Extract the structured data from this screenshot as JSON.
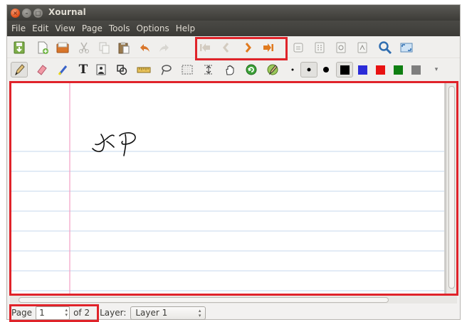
{
  "window": {
    "title": "Xournal"
  },
  "menu": [
    "File",
    "Edit",
    "View",
    "Page",
    "Tools",
    "Options",
    "Help"
  ],
  "toolbar1": {
    "icons": [
      "save-icon",
      "new-page-icon",
      "open-icon",
      "cut-icon",
      "copy-icon",
      "paste-icon",
      "undo-icon",
      "redo-icon",
      "first-page-icon",
      "previous-page-icon",
      "next-page-icon",
      "last-page-icon",
      "layer-icon",
      "page-layout-icon",
      "zoom-fit-icon",
      "zoom-out-icon",
      "zoom-icon",
      "fullscreen-icon"
    ]
  },
  "toolbar2": {
    "icons": [
      "pen-icon",
      "eraser-icon",
      "highlighter-icon",
      "text-icon",
      "image-icon",
      "shape-icon",
      "ruler-icon",
      "lasso-icon",
      "select-rect-icon",
      "vertical-space-icon",
      "hand-icon",
      "default-tool-icon",
      "default-pen-icon"
    ],
    "text_tool_label": "T",
    "colors": [
      "#000000",
      "#2c2cd8",
      "#e81212",
      "#0f7f12",
      "#7e7e7e"
    ]
  },
  "colors": {
    "highlight": "#e0232a",
    "rule_line": "#c4d7ec",
    "margin_line": "#f4a0c4",
    "ink": "#000000"
  },
  "status": {
    "page_label": "Page",
    "page_value": "1",
    "of_label": "of 2",
    "layer_label": "Layer:",
    "layer_value": "Layer 1"
  }
}
